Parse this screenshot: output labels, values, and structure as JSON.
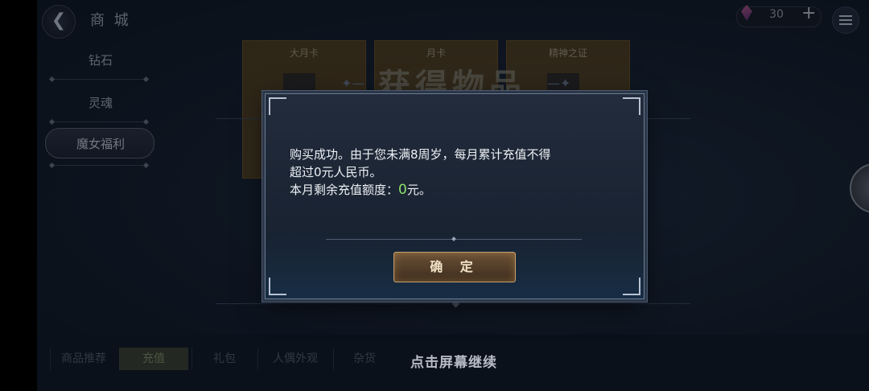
{
  "header": {
    "title": "商 城",
    "back_icon": "back-arrow-icon",
    "currency_value": "30",
    "currency_plus": "+"
  },
  "sidebar": {
    "items": [
      {
        "label": "钻石"
      },
      {
        "label": "灵魂"
      },
      {
        "label": "魔女福利",
        "active": true
      }
    ]
  },
  "shop_cards": [
    {
      "name": "大月卡"
    },
    {
      "name": "月卡"
    },
    {
      "name": "精神之证"
    }
  ],
  "background_title": "获得物品",
  "bottom_tabs": [
    {
      "label": "商品推荐"
    },
    {
      "label": "充值",
      "active": true
    },
    {
      "label": "礼包"
    },
    {
      "label": "人偶外观"
    },
    {
      "label": "杂货"
    }
  ],
  "tap_to_continue": "点击屏幕继续",
  "dialog": {
    "line1": "购买成功。由于您未满8周岁，每月累计充值不得",
    "line2": "超过0元人民币。",
    "line3_prefix": "本月剩余充值额度：",
    "line3_value": "0",
    "line3_suffix": "元。",
    "confirm_label": "确 定"
  },
  "colors": {
    "accent_green": "#8fe26b",
    "button_gold": "#c8a36c"
  }
}
